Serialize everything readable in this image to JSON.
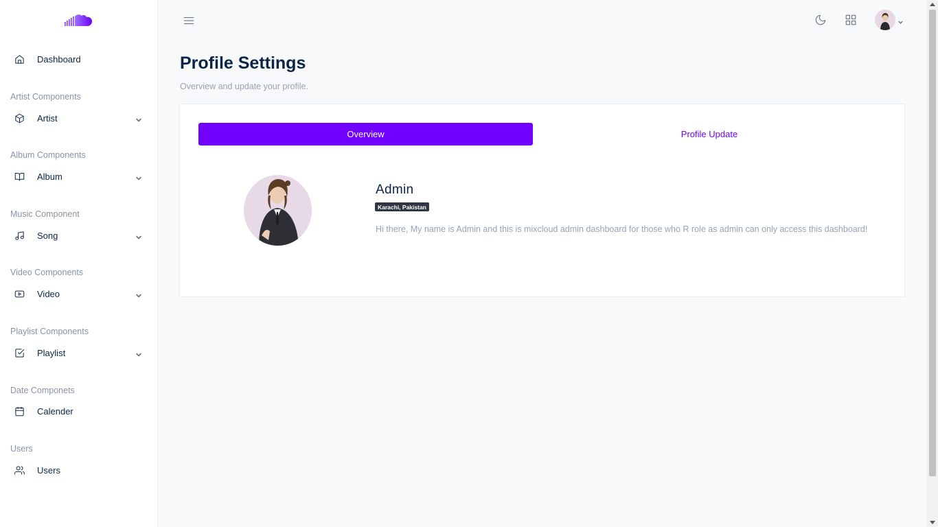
{
  "sidebar": {
    "items": [
      {
        "label": "Dashboard"
      },
      {
        "section": "Artist Components",
        "label": "Artist"
      },
      {
        "section": "Album Components",
        "label": "Album"
      },
      {
        "section": "Music Component",
        "label": "Song"
      },
      {
        "section": "Video Components",
        "label": "Video"
      },
      {
        "section": "Playlist Components",
        "label": "Playlist"
      },
      {
        "section": "Date Componets",
        "label": "Calender"
      },
      {
        "section": "Users",
        "label": "Users"
      }
    ]
  },
  "header": {
    "title": "Profile Settings",
    "subtitle": "Overview and update your profile."
  },
  "tabs": [
    {
      "label": "Overview"
    },
    {
      "label": "Profile Update"
    }
  ],
  "profile": {
    "name": "Admin",
    "location": "Karachi, Pakistan",
    "bio": "Hi there, My name is Admin and this is mixcloud admin dashboard for those who R role as admin can only access this dashboard!"
  },
  "colors": {
    "accent": "#7000ff",
    "navy": "#0b2447",
    "muted": "#9aa2b1"
  },
  "icons": [
    "cloud-logo-icon",
    "home-icon",
    "cube-icon",
    "book-icon",
    "music-icon",
    "youtube-icon",
    "check-square-icon",
    "calendar-icon",
    "users-icon",
    "menu-icon",
    "moon-icon",
    "grid-icon",
    "chevron-down-icon"
  ]
}
